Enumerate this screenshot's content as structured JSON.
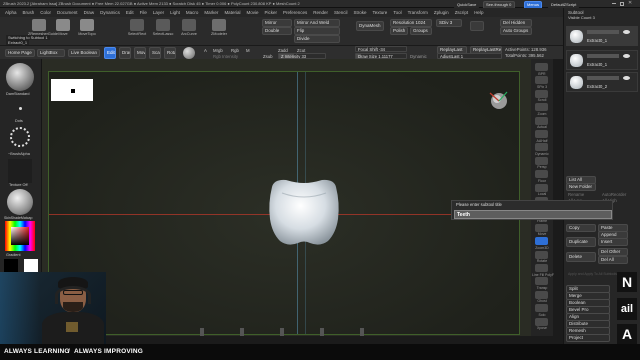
{
  "title_bar": {
    "text": "ZBrush 2023.2 [Abraham Issa]   ZBrush Document   ● Free Mem 22.027GB ● Active Mem 2133 ● Scratch Disk 45 ● Timer 0.006 ● PolyCount 230.808 KP ● MeshCount 2",
    "quicksave": "QuickSave",
    "see_through": "See-through  0",
    "menus": "Menus",
    "default_script": "DefaultZScript"
  },
  "menu_bar": {
    "items": [
      "Alpha",
      "Brush",
      "Color",
      "Document",
      "Draw",
      "Dynamics",
      "Edit",
      "File",
      "Layer",
      "Light",
      "Macro",
      "Marker",
      "Material",
      "Movie",
      "Picker",
      "Preferences",
      "Render",
      "Stencil",
      "Stroke",
      "Texture",
      "Tool",
      "Transform",
      "Zplugin",
      "Zscript",
      "Help"
    ]
  },
  "tool_shelf": {
    "items": [
      "ZRemesherGuide",
      "Move",
      "MoveTopo",
      "SelectRect",
      "SelectLasso",
      "ArcCurve",
      "ZModeler"
    ],
    "mirror_left": "Mirror",
    "mirror_weld": "Mirror And Weld",
    "double": "Double",
    "flip": "Flip",
    "divide": "Divide",
    "dyna_mesh": "DynaMesh",
    "resolution": "Resolution 1024",
    "polish": "Polish",
    "groups": "Groups",
    "sdiv": "SDiv 3",
    "del_hidden": "Del Hidden",
    "auto_groups": "Auto Groups"
  },
  "subtool_header": {
    "title": "Subtool",
    "visible_count": "Visible Count 3"
  },
  "status": {
    "switching": "Switching to Subtool 1",
    "subtool_name": "Extract0_1"
  },
  "secondary_bar": {
    "home_page": "Home Page",
    "lightbox": "LightBox",
    "live_boolean": "Live Boolean",
    "edit": "Edit",
    "draw": "Draw",
    "move": "Move",
    "scale": "Scale",
    "rotate": "Rotate",
    "a": "A",
    "mrgb": "Mrgb",
    "rgb": "Rgb",
    "m": "M",
    "zadd": "Zadd",
    "zsub": "Zsub",
    "zcut": "Zcut",
    "rgb_intensity": "Rgb Intensity",
    "z_intensity": "Z Intensity 33",
    "focal_shift": "Focal Shift -34",
    "draw_size": "Draw Size 1.11177",
    "dynamic": "Dynamic",
    "replay_last": "ReplayLast",
    "replay_last_rel": "ReplayLastRel",
    "adjust_last": "AdjustLast 1",
    "active_points": "ActivePoints: 128.936",
    "total_points": "TotalPoints: 395.562"
  },
  "left_panel": {
    "brush_label": "DamStandard",
    "stroke_label": "Dots",
    "alpha_label": "~BrushAlpha",
    "texture_label": "Texture Off",
    "material_label": "SkinShadeMatcap",
    "gradient_label": "Gradient",
    "switch_color": "SwitchColor",
    "alternate": "Alternate"
  },
  "subtools": [
    {
      "name": "Extract0_1"
    },
    {
      "name": "Extract0_1"
    },
    {
      "name": "Extract0_2"
    }
  ],
  "right_icon_labels": [
    "BPR",
    "SPix 3",
    "Scroll",
    "Zoom",
    "Actual",
    "AAHalf",
    "Dynamic",
    "Persp",
    "Floor",
    "Local",
    "XYZ",
    "Frame",
    "Move",
    "Zoom3D",
    "Rotate",
    "Line Fill PolyF",
    "Transp",
    "Ghost",
    "Solo",
    "Xpose"
  ],
  "subtool_panel": {
    "list_all": "List All",
    "new_folder": "New Folder",
    "rename": "Rename",
    "auto_reorder": "AutoReorder",
    "all_low": "All Low",
    "all_high": "All High",
    "copy": "Copy",
    "paste": "Paste",
    "append": "Append",
    "duplicate": "Duplicate",
    "insert": "Insert",
    "del_other": "Del Other",
    "delete": "Delete",
    "del_all": "Del All",
    "apply_text": "Apply and Apply To All Subtools",
    "split": "Split",
    "merge": "Merge",
    "boolean": "Boolean",
    "bevel_pro": "Bevel Pro",
    "align": "Align",
    "distribute": "Distribute",
    "remesh": "Remesh",
    "project": "Project"
  },
  "dialog": {
    "prompt": "Please enter subtool title",
    "value": "Teeth"
  },
  "watermark": {
    "left": "ALWAYS LEARNING",
    "sep": "/",
    "right": "ALWAYS IMPROVING"
  },
  "logos": [
    "N",
    "ail",
    "A"
  ],
  "colors": {
    "accent_blue": "#2e6fd6",
    "accent_orange": "#d77a25",
    "canvas_bg": "#222519",
    "gradient_black": "#000000",
    "gradient_white": "#ffffff",
    "frame_green": "#3f5f2a",
    "axis_red": "#c0392b"
  }
}
